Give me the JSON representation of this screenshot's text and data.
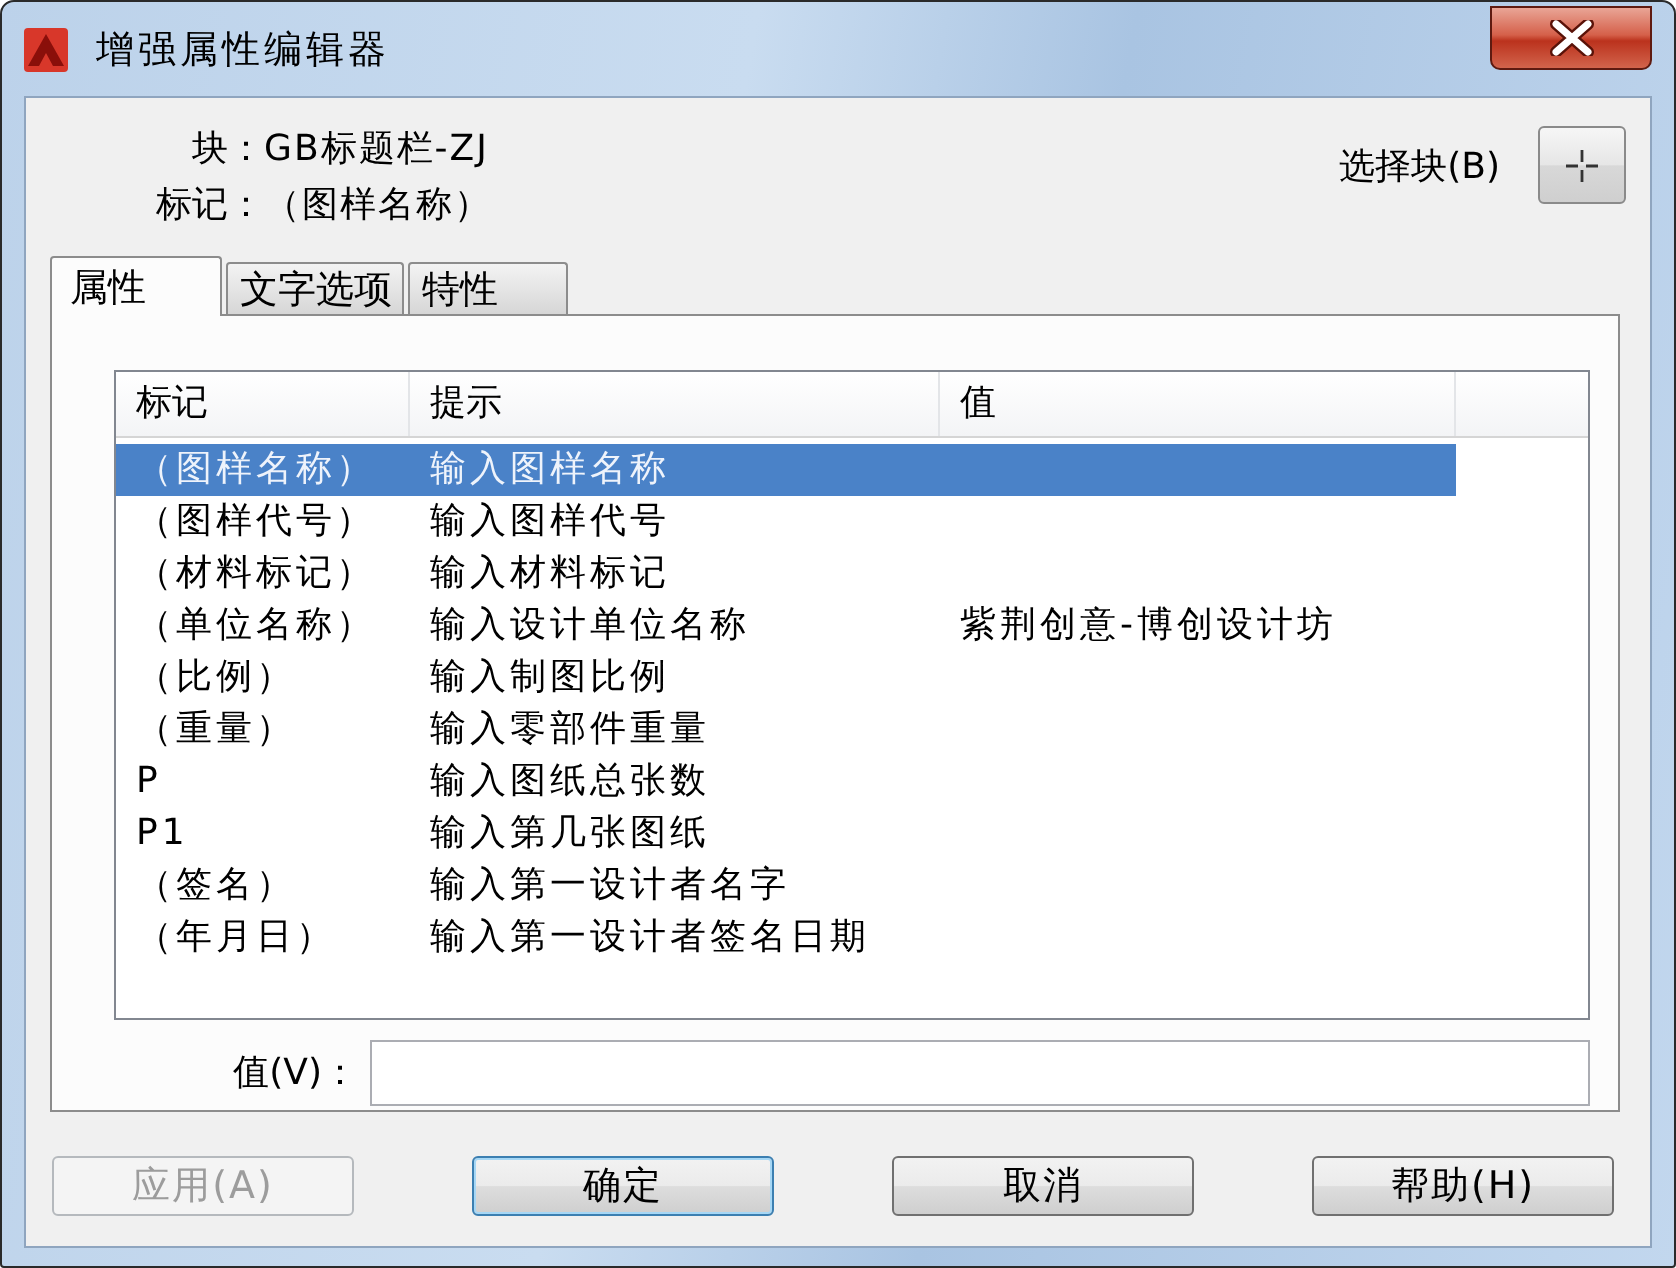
{
  "window": {
    "title": "增强属性编辑器"
  },
  "block": {
    "label": "块：",
    "value": "GB标题栏-ZJ"
  },
  "tag": {
    "label": "标记：",
    "value": "（图样名称）"
  },
  "select_block": {
    "label": "选择块(B)"
  },
  "tabs": [
    {
      "label": "属性",
      "selected": true
    },
    {
      "label": "文字选项",
      "selected": false
    },
    {
      "label": "特性",
      "selected": false
    }
  ],
  "attributes": {
    "columns": [
      "标记",
      "提示",
      "值"
    ],
    "rows": [
      {
        "tag": "（图样名称）",
        "prompt": "输入图样名称",
        "selected": true
      },
      {
        "tag": "（图样代号）",
        "prompt": "输入图样代号",
        "selected": false
      },
      {
        "tag": "（材料标记）",
        "prompt": "输入材料标记",
        "selected": false
      },
      {
        "tag": "（单位名称）",
        "prompt": "输入设计单位名称",
        "value": "紫荆创意-博创设计坊",
        "selected": false
      },
      {
        "tag": "（比例）",
        "prompt": "输入制图比例",
        "selected": false
      },
      {
        "tag": "（重量）",
        "prompt": "输入零部件重量",
        "selected": false
      },
      {
        "tag": "P",
        "prompt": "输入图纸总张数",
        "selected": false
      },
      {
        "tag": "P1",
        "prompt": "输入第几张图纸",
        "selected": false
      },
      {
        "tag": "（签名）",
        "prompt": "输入第一设计者名字",
        "selected": false
      },
      {
        "tag": "（年月日）",
        "prompt": "输入第一设计者签名日期",
        "selected": false
      }
    ]
  },
  "value_field": {
    "label": "值(V)："
  },
  "buttons": [
    {
      "label": "应用(A)",
      "disabled": true,
      "default": false
    },
    {
      "label": "确定",
      "disabled": false,
      "default": true
    },
    {
      "label": "取消",
      "disabled": false,
      "default": false
    },
    {
      "label": "帮助(H)",
      "disabled": false,
      "default": false
    }
  ]
}
